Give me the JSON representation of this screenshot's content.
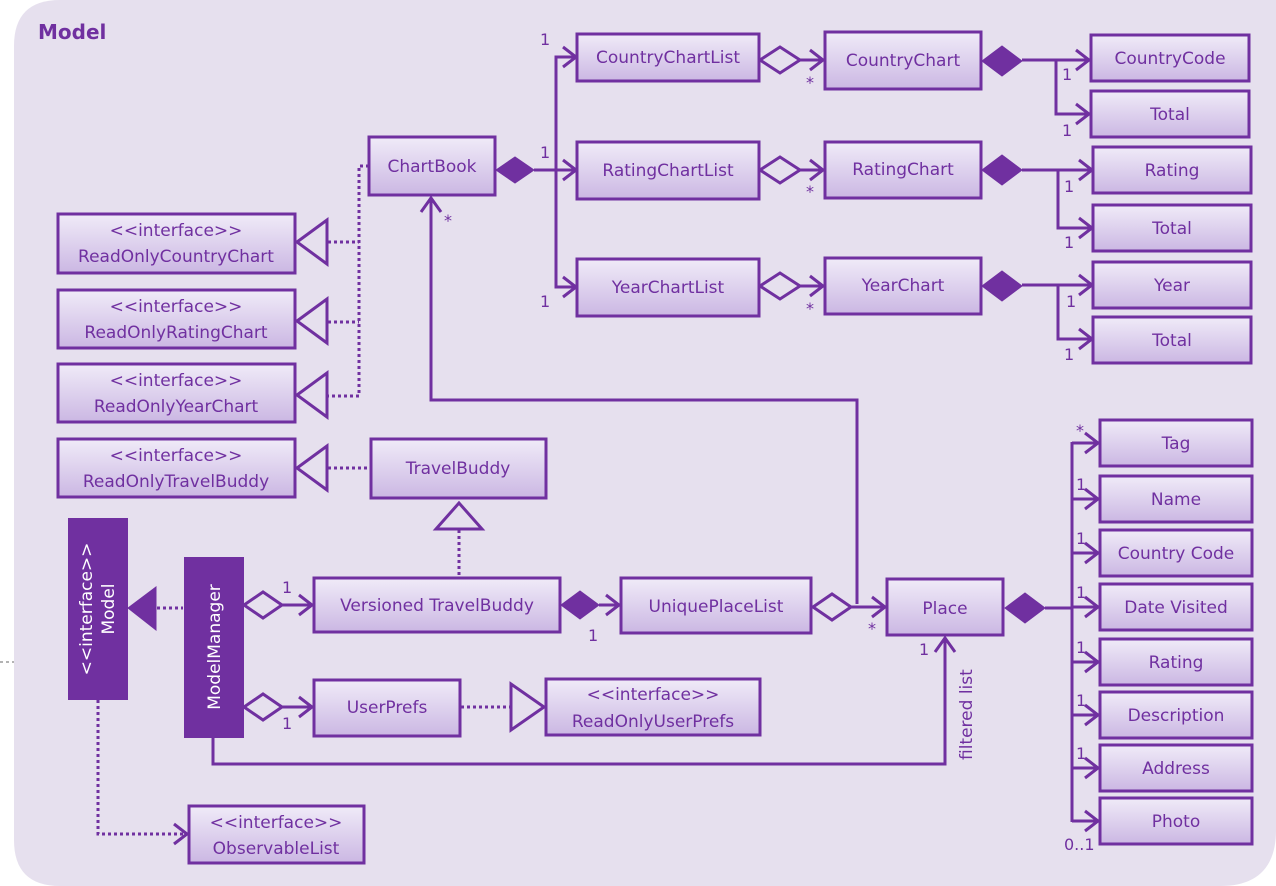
{
  "package_title": "Model",
  "colors": {
    "accent": "#7030a0",
    "frame_background": "#e6e0ee",
    "box_gradient_top": "#f0ebf8",
    "box_gradient_bottom": "#cbb7e3"
  },
  "classes": {
    "chart_book": "ChartBook",
    "country_chart_list": "CountryChartList",
    "rating_chart_list": "RatingChartList",
    "year_chart_list": "YearChartList",
    "country_chart": "CountryChart",
    "rating_chart": "RatingChart",
    "year_chart": "YearChart",
    "country_code": "CountryCode",
    "country_total": "Total",
    "rating": "Rating",
    "rating_total": "Total",
    "year": "Year",
    "year_total": "Total",
    "travel_buddy": "TravelBuddy",
    "versioned_travel_buddy": "Versioned TravelBuddy",
    "unique_place_list": "UniquePlaceList",
    "place": "Place",
    "user_prefs": "UserPrefs",
    "model_manager": "ModelManager",
    "model": "Model"
  },
  "interfaces": {
    "stereotype": "<<interface>>",
    "read_only_country_chart": "ReadOnlyCountryChart",
    "read_only_rating_chart": "ReadOnlyRatingChart",
    "read_only_year_chart": "ReadOnlyYearChart",
    "read_only_travel_buddy": "ReadOnlyTravelBuddy",
    "read_only_user_prefs": "ReadOnlyUserPrefs",
    "observable_list": "ObservableList",
    "model": "Model"
  },
  "place_attributes": [
    {
      "name": "Tag",
      "multiplicity": "*"
    },
    {
      "name": "Name",
      "multiplicity": "1"
    },
    {
      "name": "Country Code",
      "multiplicity": "1"
    },
    {
      "name": "Date Visited",
      "multiplicity": "1"
    },
    {
      "name": "Rating",
      "multiplicity": "1"
    },
    {
      "name": "Description",
      "multiplicity": "1"
    },
    {
      "name": "Address",
      "multiplicity": "1"
    },
    {
      "name": "Photo",
      "multiplicity": "0..1"
    }
  ],
  "multiplicities": {
    "one": "1",
    "many": "*",
    "zero_or_one": "0..1"
  },
  "labels": {
    "filtered_list": "filtered list"
  }
}
